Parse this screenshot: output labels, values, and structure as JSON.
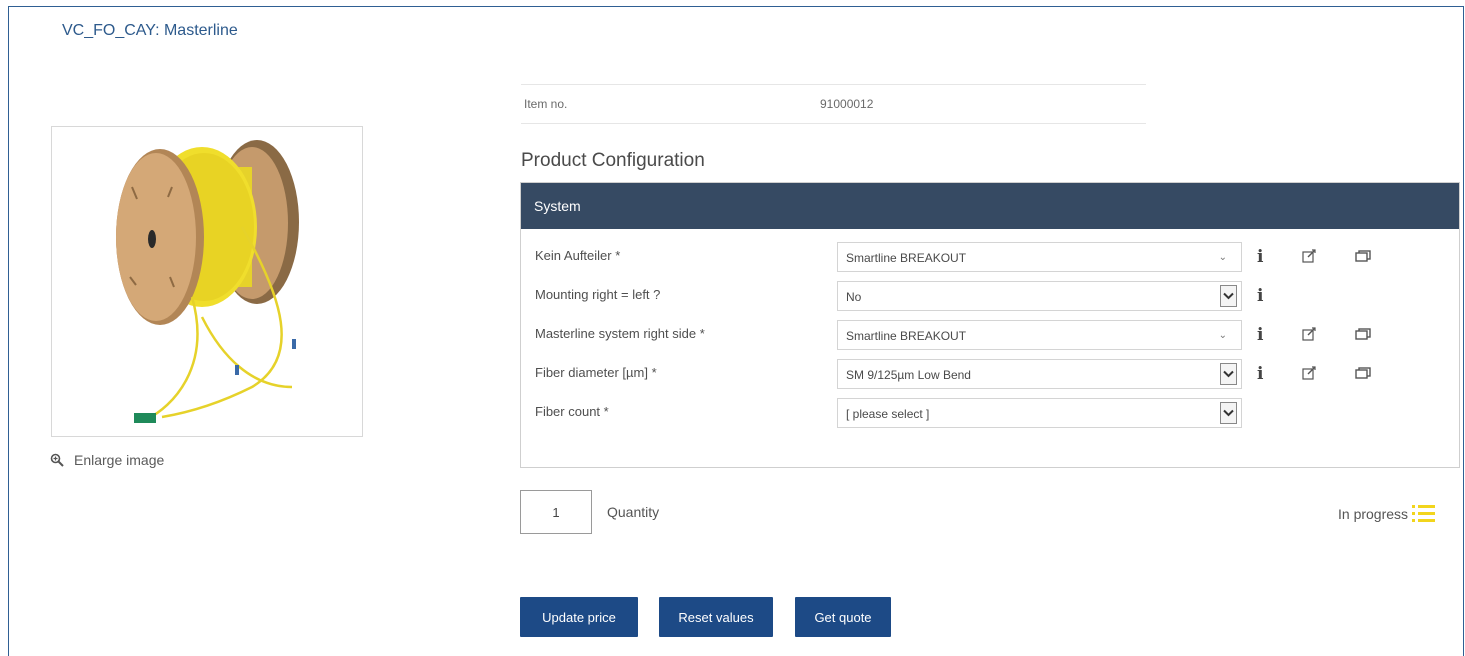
{
  "page": {
    "title": "VC_FO_CAY: Masterline"
  },
  "media": {
    "enlarge_label": "Enlarge image"
  },
  "item": {
    "label": "Item no.",
    "value": "91000012"
  },
  "configuration": {
    "heading": "Product Configuration",
    "section_title": "System",
    "rows": [
      {
        "label": "Kein Aufteiler *",
        "value": "Smartline BREAKOUT",
        "chevron": "plain",
        "icons": [
          "info-icon",
          "edit-icon",
          "copy-icon"
        ]
      },
      {
        "label": "Mounting right = left ?",
        "value": "No",
        "chevron": "boxed",
        "icons": [
          "info-icon"
        ]
      },
      {
        "label": "Masterline system right side *",
        "value": "Smartline BREAKOUT",
        "chevron": "plain",
        "icons": [
          "info-icon",
          "edit-icon",
          "copy-icon"
        ]
      },
      {
        "label": "Fiber diameter [µm] *",
        "value": "SM 9/125µm Low Bend",
        "chevron": "boxed",
        "icons": [
          "info-icon",
          "edit-icon",
          "copy-icon"
        ]
      },
      {
        "label": "Fiber count *",
        "value": "[ please select ]",
        "chevron": "boxed",
        "icons": []
      }
    ]
  },
  "quantity": {
    "value": "1",
    "label": "Quantity"
  },
  "status": {
    "label": "In progress",
    "icon": "list-icon",
    "color": "#f2d51c"
  },
  "actions": {
    "update_price": "Update price",
    "reset_values": "Reset values",
    "get_quote": "Get quote"
  },
  "colors": {
    "accent": "#1d4a86",
    "header_bg": "#364a63",
    "frame_border": "#2f5f93",
    "title": "#2d5a8c"
  }
}
